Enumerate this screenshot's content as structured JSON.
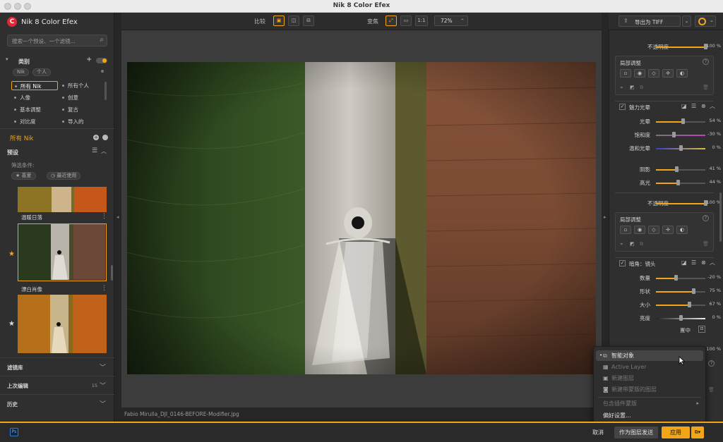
{
  "window": {
    "title": "Nik 8 Color Efex"
  },
  "left": {
    "brand": "Nik 8 Color Efex",
    "search_placeholder": "搜索一个预设、一个滤镜...",
    "category_header": "类别",
    "chips": [
      "Nik",
      "个人"
    ],
    "categories": [
      "所有 Nik",
      "所有个人",
      "人像",
      "创意",
      "基本调整",
      "复古",
      "对比度",
      "导入的"
    ],
    "section_label": "所有 Nik",
    "presets_header": "预设",
    "filter_label": "筛选条件:",
    "filter_chips": [
      "★ 喜爱",
      "◷ 最近使用"
    ],
    "presets": [
      {
        "label": "温暖日落"
      },
      {
        "label": "漂白肖像"
      },
      {
        "label": ""
      }
    ],
    "accordions": [
      {
        "label": "滤镜库",
        "count": ""
      },
      {
        "label": "上次编辑",
        "count": "15"
      },
      {
        "label": "历史",
        "count": ""
      }
    ]
  },
  "toolbar": {
    "compare_label": "比较",
    "transform_label": "变焦",
    "zoom_fit": "1:1",
    "zoom_value": "72%"
  },
  "canvas": {
    "filename": "Fabio Mirulla_DJI_0146-BEFORE-Modifier.jpg"
  },
  "right": {
    "export_label": "导出为 TIFF",
    "opacity_label": "不透明度",
    "opacity_value": "100 %",
    "opacity_level": 1.0,
    "local_adjust_label": "局部调整",
    "glamour": {
      "title": "魅力光晕",
      "rows": [
        {
          "label": "光晕",
          "value": "54 %",
          "level": 0.54
        },
        {
          "label": "饱和度",
          "value": "-30 %",
          "level": 0.35
        },
        {
          "label": "温和光晕",
          "value": "0 %",
          "level": 0.5
        },
        {
          "label": "阴影",
          "value": "41 %",
          "level": 0.41
        },
        {
          "label": "高光",
          "value": "44 %",
          "level": 0.44
        }
      ]
    },
    "opacity2_label": "不透明度",
    "opacity2_value": "100 %",
    "local_adjust2_label": "局部调整",
    "vignette": {
      "title": "暗角：镜头",
      "rows": [
        {
          "label": "数量",
          "value": "-20 %",
          "level": 0.4
        },
        {
          "label": "形状",
          "value": "75 %",
          "level": 0.75
        },
        {
          "label": "大小",
          "value": "67 %",
          "level": 0.67
        },
        {
          "label": "亮度",
          "value": "0 %",
          "level": 0.5
        }
      ],
      "center_label": "置中"
    },
    "opacity3_value": "100 %"
  },
  "menu": {
    "items": [
      {
        "label": "智能对象",
        "enabled": true,
        "highlight": true
      },
      {
        "label": "Active Layer",
        "enabled": false
      },
      {
        "label": "新建图层",
        "enabled": false
      },
      {
        "label": "新建带蒙版的图层",
        "enabled": false
      },
      {
        "label": "包含插件蒙版",
        "enabled": false
      },
      {
        "label": "偏好设置...",
        "enabled": true
      }
    ]
  },
  "bottom": {
    "app_badge": "Ps",
    "cancel": "取消",
    "send_as_layer": "作为图层发送",
    "apply": "应用"
  },
  "colors": {
    "accent": "#f2a516",
    "brand": "#e0263a"
  }
}
